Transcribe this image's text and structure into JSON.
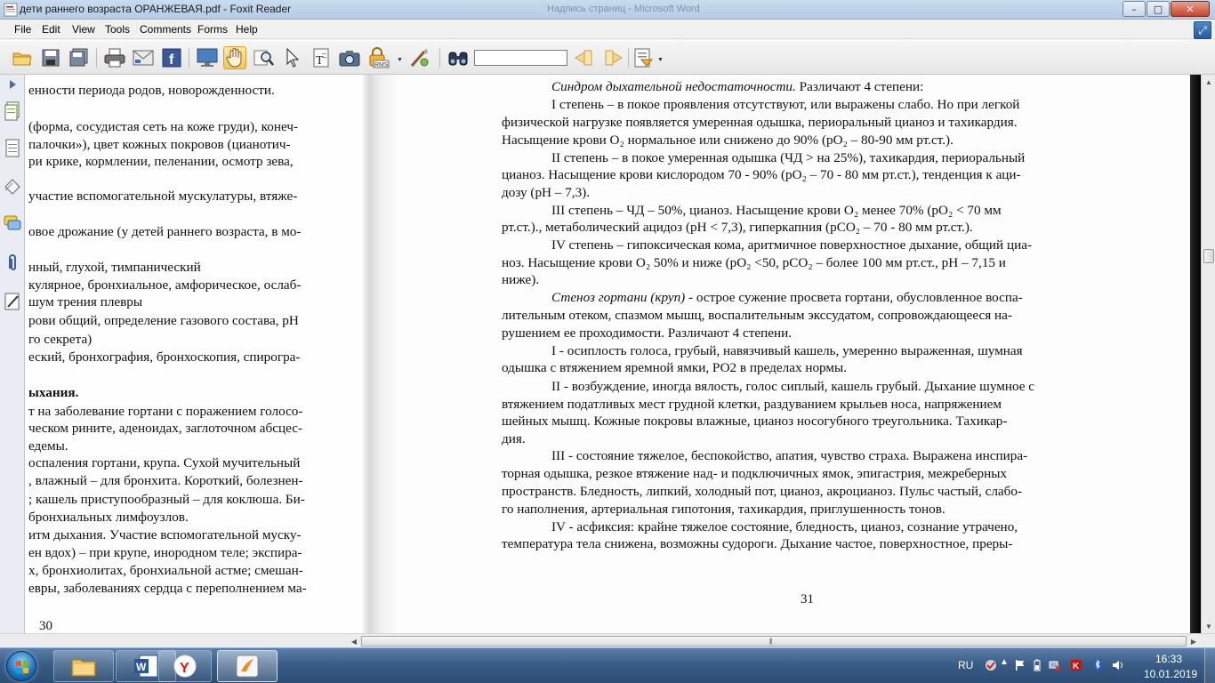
{
  "window": {
    "title": "дети раннего возраста ОРАНЖЕВАЯ.pdf - Foxit Reader",
    "background_title": "Надпись страниц - Microsoft Word",
    "buttons": {
      "minimize": "–",
      "maximize": "□",
      "close": "✕"
    }
  },
  "menu": [
    "File",
    "Edit",
    "View",
    "Tools",
    "Comments",
    "Forms",
    "Help"
  ],
  "toolbar": {
    "find_value": "",
    "icons": [
      "open-icon",
      "save-icon",
      "save-all-icon",
      "print-icon",
      "email-icon",
      "facebook-icon",
      "fullscreen-icon",
      "hand-icon",
      "zoom-icon",
      "select-icon",
      "text-select-icon",
      "snapshot-icon",
      "rms-icon",
      "typewriter-icon",
      "find-icon",
      "find-prev-icon",
      "find-next-icon",
      "page-setup-icon"
    ],
    "rms_label": "RMS"
  },
  "left_page": {
    "lines": [
      "енности периода родов, новорожденности.",
      "(форма, сосудистая сеть на коже груди), конеч-",
      "палочки»), цвет кожных покровов (цианотич-",
      "ри крике, кормлении, пеленании, осмотр зева,",
      "участие вспомогательной мускулатуры, втяже-",
      "овое дрожание (у детей раннего возраста, в мо-",
      "нный, глухой, тимпанический",
      "кулярное, бронхиальное, амфорическое, ослаб-",
      "шум трения плевры",
      "рови общий, определение газового состава, рН",
      "го секрета)",
      "еский, бронхография, бронхоскопия, спирогра-",
      "ыхания.",
      "т на заболевание гортани с поражением голосо-",
      "ческом рините, аденоидах, заглоточном абсцес-",
      "едемы.",
      "оспаления гортани, крупа. Сухой мучительный",
      ", влажный – для бронхита. Короткий, болезнен-",
      "; кашель приступообразный – для коклюша. Би-",
      "бронхиальных лимфоузлов.",
      "итм дыхания. Участие вспомогательной муску-",
      "ен вдох) – при крупе, инородном теле; экспира-",
      "х, бронхиолитах, бронхиальной астме; смешан-",
      "евры, заболеваниях сердца с переполнением ма-"
    ],
    "page_number": "30"
  },
  "right_page": {
    "heading_italic": "Синдром дыхательной недостаточности.",
    "heading_rest": " Различают 4 степени:",
    "lines": [
      "I степень – в покое проявления отсутствуют, или выражены слабо. Но при легкой",
      "физической нагрузке появляется умеренная одышка, периоральный цианоз и тахикардия.",
      "Насыщение крови О₂ нормальное или снижено до 90% (рО₂ – 80-90 мм рт.ст.).",
      "II степень – в покое умеренная одышка (ЧД > на 25%), тахикардия, периоральный",
      "цианоз. Насыщение крови кислородом 70 - 90% (рО₂ – 70 - 80 мм рт.ст.), тенденция к аци-",
      "дозу (рН – 7,3).",
      "III степень – ЧД – 50%, цианоз. Насыщение крови О₂ менее 70% (рО₂ < 70 мм",
      "рт.ст.)., метаболический ацидоз (рН < 7,3), гиперкапния (рСО₂ – 70 - 80 мм рт.ст.).",
      "IV степень – гипоксическая кома, аритмичное поверхностное дыхание, общий циа-",
      "ноз. Насыщение крови О₂ 50% и ниже (рО₂ <50, рСО₂ – более 100 мм рт.ст., рН – 7,15 и",
      "ниже)."
    ],
    "stenosis_italic": "Стеноз гортани (круп)",
    "stenosis_lines": [
      " - острое сужение просвета гортани, обусловленное воспа-",
      "лительным отеком, спазмом мышц, воспалительным экссудатом, сопровождающееся на-",
      "рушением ее проходимости. Различают 4 степени.",
      "I - осиплость голоса, грубый, навязчивый кашель, умеренно выраженная, шумная",
      "одышка с втяжением яремной ямки, РО2 в пределах нормы.",
      "II - возбуждение, иногда вялость, голос сиплый, кашель грубый. Дыхание шумное с",
      "втяжением податливых мест грудной клетки, раздуванием крыльев носа, напряжением",
      "шейных мышц. Кожные покровы влажные, цианоз носогубного треугольника. Тахикар-",
      "дия.",
      "III - состояние тяжелое, беспокойство, апатия, чувство страха. Выражена инспира-",
      "торная одышка, резкое втяжение над- и подключичных ямок, эпигастрия, межреберных",
      "пространств. Бледность, липкий, холодный пот, цианоз, акроцианоз. Пульс частый, слабо-",
      "го наполнения, артериальная гипотония, тахикардия, приглушенность тонов.",
      "IV - асфиксия: крайне тяжелое состояние, бледность, цианоз, сознание утрачено,",
      "температура тела снижена, возможны судороги. Дыхание частое, поверхностное, преры-"
    ],
    "page_number": "31"
  },
  "taskbar": {
    "language": "RU",
    "time": "16:33",
    "date": "10.01.2019",
    "apps": [
      "explorer-icon",
      "word-icon",
      "yandex-icon",
      "foxit-icon"
    ]
  },
  "colors": {
    "accent_taskbar": "#3a5d86",
    "title_bar": "#c9dcef",
    "doc_background": "#6b6b6b"
  }
}
